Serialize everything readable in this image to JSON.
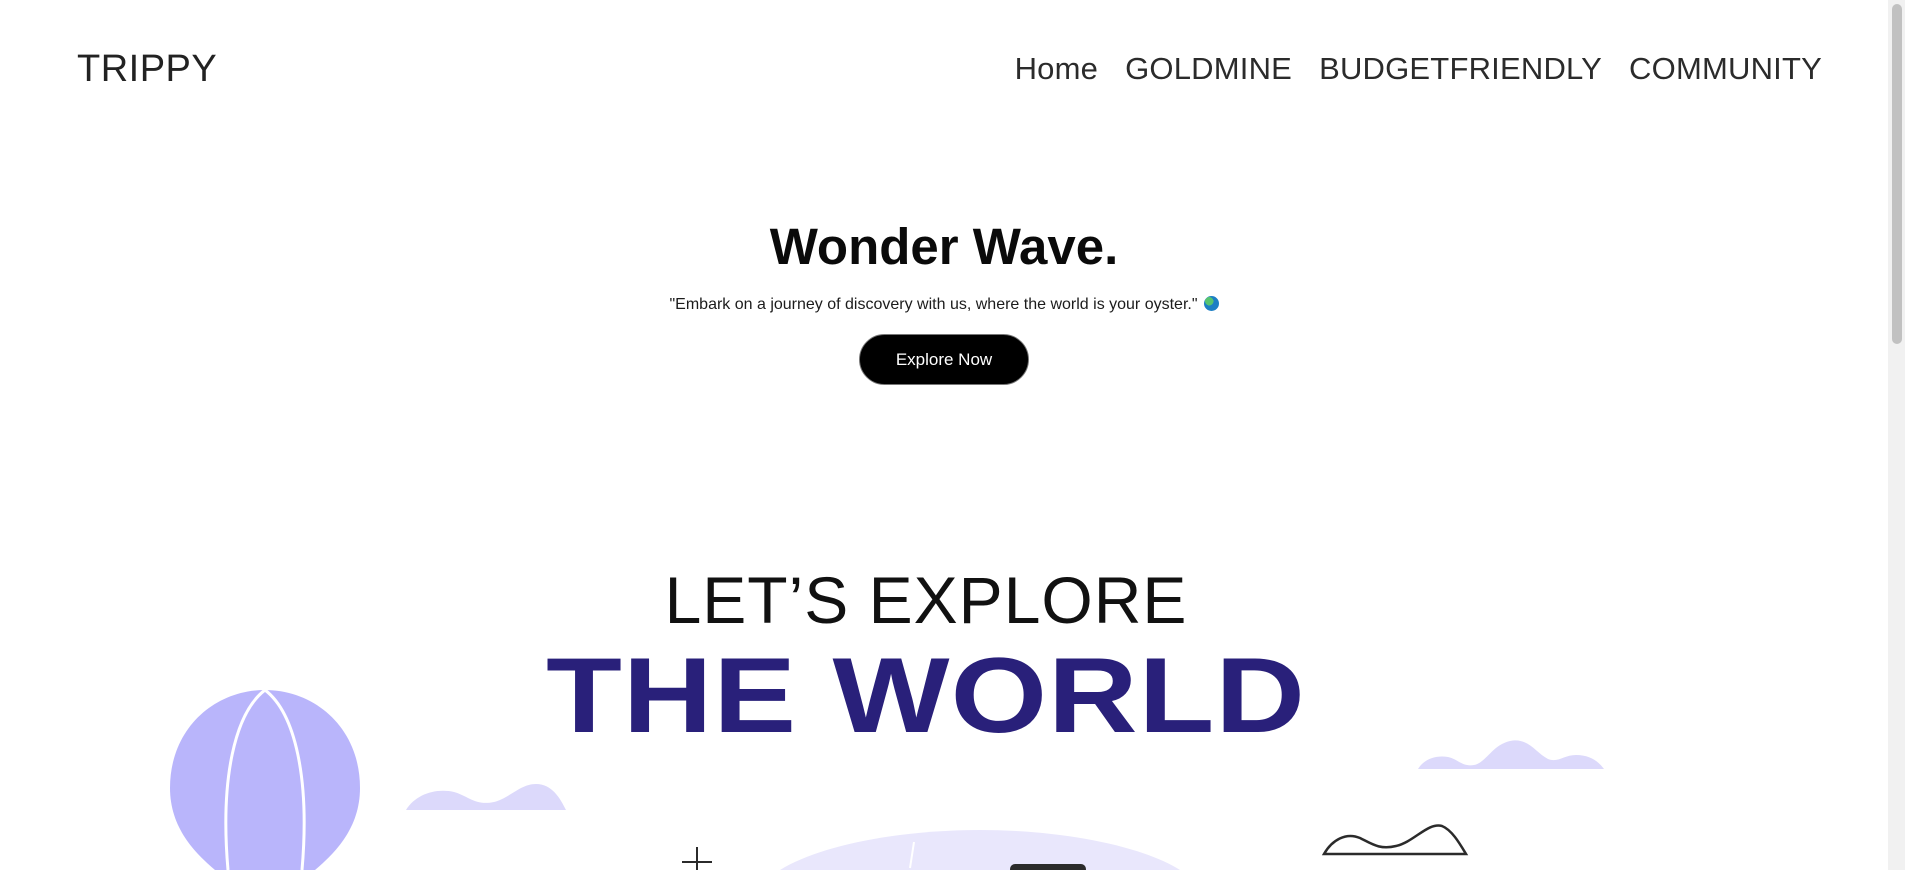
{
  "header": {
    "logo": "TRIPPY",
    "nav": [
      "Home",
      "GOLDMINE",
      "BUDGETFRIENDLY",
      "COMMUNITY"
    ]
  },
  "hero": {
    "title": "Wonder Wave.",
    "tagline": "\"Embark on a journey of discovery with us, where the world is your oyster.\"",
    "tagline_icon": "globe-icon",
    "cta_label": "Explore Now"
  },
  "explore": {
    "kicker": "LET’S EXPLORE",
    "headline": "THE WORLD"
  },
  "colors": {
    "accent_navy": "#29207a",
    "balloon_lavender": "#b9b5fb",
    "cloud_lavender": "#dcd9fb",
    "button_black": "#000000"
  }
}
